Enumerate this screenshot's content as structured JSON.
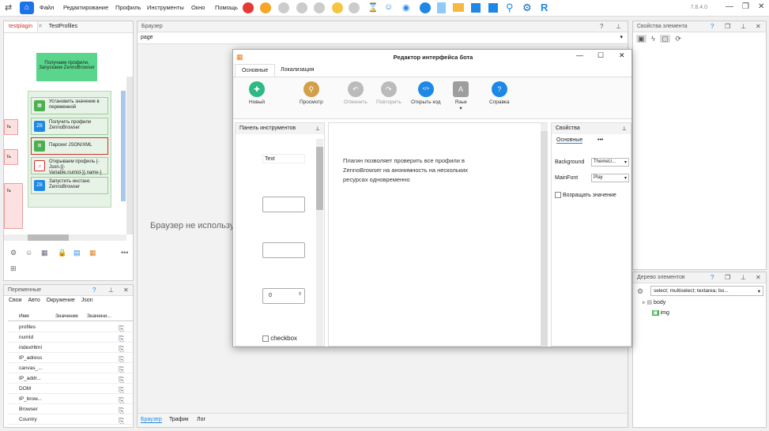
{
  "menu": [
    "Файл",
    "Редактирование",
    "Профиль",
    "Инструменты",
    "Окно",
    "Помощь"
  ],
  "version": "7.8.4.0",
  "left_tabs": [
    "testplagin",
    "TestProfiles"
  ],
  "nodes": {
    "main": "Получаем профили, Запускаем ZennoBrowser",
    "set_var": "Установить значение в переменной",
    "get_profiles": "Получить профили ZennoBrowser",
    "parse_json": "Парсинг JSON/XML",
    "open_profile": "Открываем профиль {-Json.{{-Variable.numId-}}.name-}",
    "launch": "Запустить инстанс ZennoBrowser",
    "side_ok": "ть",
    "side2": "ть",
    "side3": "ть"
  },
  "vars": {
    "title": "Переменные",
    "tabs": [
      "Свои",
      "Авто",
      "Окружение",
      "Json"
    ],
    "cols": [
      "Имя",
      "Значение",
      "Значени..."
    ],
    "rows": [
      "profiles",
      "numId",
      "indexHtml",
      "IP_adress",
      "canvas_...",
      "IP_addr...",
      "DOM",
      "IP_brow...",
      "Browser",
      "Country"
    ]
  },
  "browser": {
    "title": "Браузер",
    "tab": "page",
    "msg": "Браузер не используется",
    "bottom_tabs": [
      "Браузер",
      "Трафик",
      "Лог"
    ]
  },
  "dialog": {
    "title": "Редактор интерфейса бота",
    "tabs": [
      "Основные",
      "Локализация"
    ],
    "buttons": [
      {
        "label": "Новый",
        "color": "#2eb886",
        "icon": "+"
      },
      {
        "label": "Просмотр",
        "color": "#d3a04a",
        "icon": "⚲"
      },
      {
        "label": "Отменить",
        "color": "#bbb",
        "icon": "↶"
      },
      {
        "label": "Повторить",
        "color": "#bbb",
        "icon": "↷"
      },
      {
        "label": "Открыть код",
        "color": "#1e88e5",
        "icon": "</>"
      },
      {
        "label": "Язык",
        "color": "#9e9e9e",
        "icon": "A"
      },
      {
        "label": "Справка",
        "color": "#1e88e5",
        "icon": "?"
      }
    ],
    "toolbox": {
      "title": "Панель инструментов",
      "text_label": "Text",
      "spinner": "0",
      "checkbox": "checkbox"
    },
    "canvas_text": "Плагин позволяет проверить все профили в ZennoBrowser на анонимность на нескольких ресурсах одновременно",
    "props": {
      "title": "Свойства",
      "tab": "Основные",
      "more": "•••",
      "bg_label": "Background",
      "bg_value": "ThemeU...",
      "font_label": "MainFont",
      "font_value": "Play",
      "return_label": "Возращать значение"
    }
  },
  "right": {
    "props_title": "Свойства элемента",
    "tree_title": "Дерево элементов",
    "filter": "select; multiselect; textarea; bo...",
    "tree": [
      "body",
      "img"
    ]
  }
}
